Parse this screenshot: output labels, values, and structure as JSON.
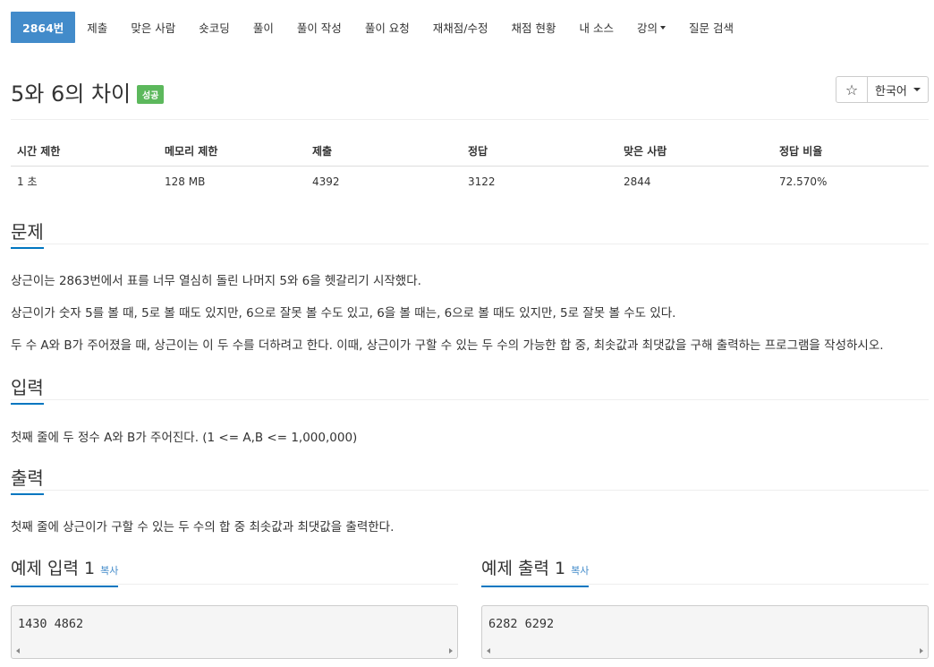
{
  "tabs": [
    {
      "label": "2864번",
      "active": true
    },
    {
      "label": "제출"
    },
    {
      "label": "맞은 사람"
    },
    {
      "label": "숏코딩"
    },
    {
      "label": "풀이"
    },
    {
      "label": "풀이 작성"
    },
    {
      "label": "풀이 요청"
    },
    {
      "label": "재채점/수정"
    },
    {
      "label": "채점 현황"
    },
    {
      "label": "내 소스"
    },
    {
      "label": "강의",
      "dropdown": true
    },
    {
      "label": "질문 검색"
    }
  ],
  "problem": {
    "title": "5와 6의 차이",
    "status_badge": "성공",
    "star_icon": "star-icon",
    "language": "한국어"
  },
  "info_table": {
    "headers": [
      "시간 제한",
      "메모리 제한",
      "제출",
      "정답",
      "맞은 사람",
      "정답 비율"
    ],
    "values": [
      "1 초",
      "128 MB",
      "4392",
      "3122",
      "2844",
      "72.570%"
    ]
  },
  "sections": {
    "problem": {
      "heading": "문제",
      "paragraphs": [
        "상근이는 2863번에서 표를 너무 열심히 돌린 나머지 5와 6을 헷갈리기 시작했다.",
        "상근이가 숫자 5를 볼 때, 5로 볼 때도 있지만, 6으로 잘못 볼 수도 있고, 6을 볼 때는, 6으로 볼 때도 있지만, 5로 잘못 볼 수도 있다.",
        "두 수 A와 B가 주어졌을 때, 상근이는 이 두 수를 더하려고 한다. 이때, 상근이가 구할 수 있는 두 수의 가능한 합 중, 최솟값과 최댓값을 구해 출력하는 프로그램을 작성하시오."
      ]
    },
    "input": {
      "heading": "입력",
      "text": "첫째 줄에 두 정수 A와 B가 주어진다. (1 <= A,B <= 1,000,000)"
    },
    "output": {
      "heading": "출력",
      "text": "첫째 줄에 상근이가 구할 수 있는 두 수의 합 중 최솟값과 최댓값을 출력한다."
    }
  },
  "examples": {
    "input": {
      "heading": "예제 입력 1",
      "copy_label": "복사",
      "content": "1430 4862"
    },
    "output": {
      "heading": "예제 출력 1",
      "copy_label": "복사",
      "content": "6282 6292"
    }
  },
  "colors": {
    "active_tab": "#428bca",
    "success_badge": "#5cb85c",
    "heading_underline": "#0076c0",
    "link": "#428bca"
  }
}
